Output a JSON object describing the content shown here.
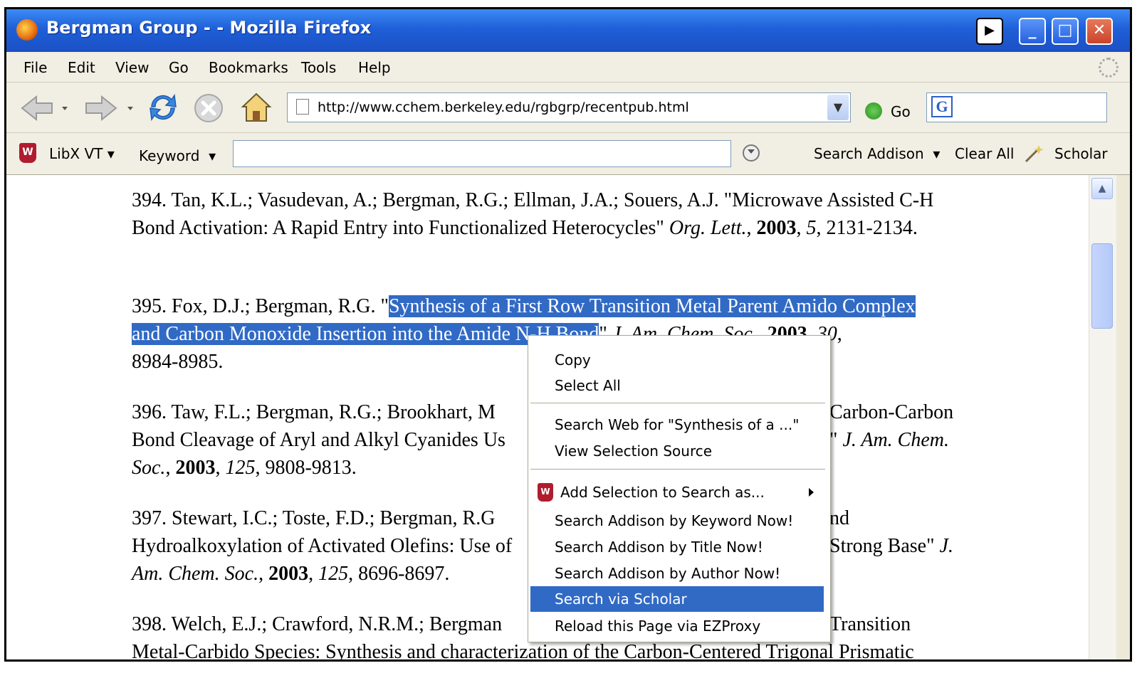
{
  "window": {
    "title": "Bergman Group - - Mozilla Firefox"
  },
  "menubar": [
    "File",
    "Edit",
    "View",
    "Go",
    "Bookmarks",
    "Tools",
    "Help"
  ],
  "nav": {
    "url": "http://www.cchem.berkeley.edu/rgbgrp/recentpub.html",
    "go_label": "Go"
  },
  "libx": {
    "name": "LibX VT",
    "search_type": "Keyword",
    "search_target": "Search Addison",
    "clear_label": "Clear All",
    "scholar_label": "Scholar"
  },
  "publications": [
    {
      "num": "394.",
      "authors": "Tan, K.L.; Vasudevan, A.; Bergman, R.G.; Ellman, J.A.; Souers, A.J.",
      "title": "\"Microwave Assisted C-H Bond Activation: A Rapid Entry into Functionalized Heterocycles\"",
      "journal": "Org. Lett.",
      "year": "2003",
      "volume": "5",
      "pages": "2131-2134."
    },
    {
      "num": "395.",
      "authors": "Fox, D.J.; Bergman, R.G.",
      "title_open": "\"",
      "title_sel1": "Synthesis of a First Row Transition Metal Parent Amido Complex",
      "title_sel2": "and Carbon Monoxide Insertion into the Amide N-H Bond",
      "title_close": "\"",
      "journal": "J. Am. Chem. Soc.",
      "year": "2003",
      "volume": "30",
      "pages": "8984-8985."
    },
    {
      "num": "396.",
      "line1a": "396. Taw, F.L.; Bergman, R.G.; Brookhart, M",
      "line1b": "Carbon-Carbon",
      "line2a": "Bond Cleavage of Aryl and Alkyl Cyanides Us",
      "line2b": "\" J. Am. Chem.",
      "journal_end": "Soc.",
      "year": "2003",
      "volume": "125",
      "pages": "9808-9813."
    },
    {
      "num": "397.",
      "line1a": "397. Stewart, I.C.; Toste, F.D.; Bergman, R.G",
      "line1b": "nd",
      "line2a": "Hydroalkoxylation of Activated Olefins: Use of",
      "line2b": "Strong Base\"",
      "line2c": "J.",
      "journal_end": "Am. Chem. Soc.",
      "year": "2003",
      "volume": "125",
      "pages": "8696-8697."
    },
    {
      "num": "398.",
      "line1a": "398. Welch, E.J.; Crawford, N.R.M.; Bergman",
      "line1b": "Transition",
      "line2": "Metal-Carbido Species: Synthesis and characterization of the Carbon-Centered Trigonal Prismatic"
    }
  ],
  "context_menu": {
    "items": [
      "Copy",
      "Select All",
      "Search Web for \"Synthesis of a ...\"",
      "View Selection Source",
      "Add Selection to Search as...",
      "Search Addison by Keyword Now!",
      "Search Addison by Title Now!",
      "Search Addison by Author Now!",
      "Search via Scholar",
      "Reload this Page via EZProxy"
    ],
    "highlighted": "Search via Scholar"
  }
}
